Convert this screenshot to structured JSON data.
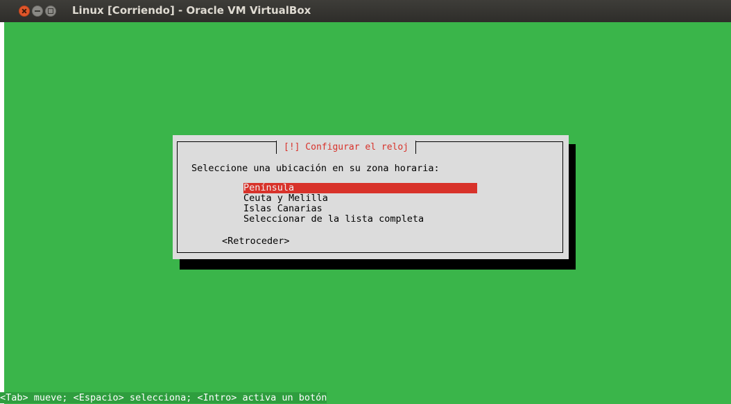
{
  "window": {
    "title": "Linux [Corriendo] - Oracle VM VirtualBox",
    "controls": [
      "close-icon",
      "minimize-icon",
      "maximize-icon"
    ]
  },
  "dialog": {
    "title": "[!] Configurar el reloj",
    "prompt": "Seleccione una ubicación en su zona horaria:",
    "options": [
      {
        "label": "Península",
        "selected": true
      },
      {
        "label": "Ceuta y Melilla",
        "selected": false
      },
      {
        "label": "Islas Canarias",
        "selected": false
      },
      {
        "label": "Seleccionar de la lista completa",
        "selected": false
      }
    ],
    "back_button": "<Retroceder>"
  },
  "status_bar": "<Tab> mueve; <Espacio> selecciona; <Intro> activa un botón",
  "colors": {
    "screen_bg": "#3ab54a",
    "dialog_bg": "#dcdcdc",
    "accent": "#d8322a"
  }
}
